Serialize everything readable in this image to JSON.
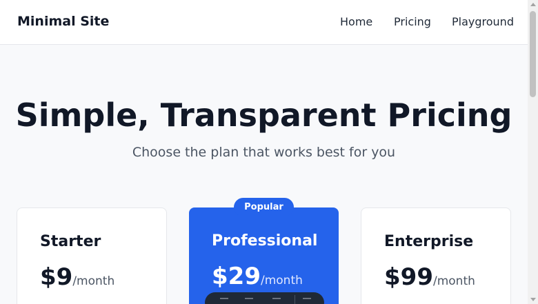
{
  "header": {
    "brand": "Minimal Site",
    "nav": [
      "Home",
      "Pricing",
      "Playground"
    ]
  },
  "hero": {
    "title": "Simple, Transparent Pricing",
    "subtitle": "Choose the plan that works best for you"
  },
  "plans": [
    {
      "name": "Starter",
      "price": "$9",
      "period": "/month"
    },
    {
      "name": "Professional",
      "price": "$29",
      "period": "/month",
      "badge": "Popular"
    },
    {
      "name": "Enterprise",
      "price": "$99",
      "period": "/month"
    }
  ],
  "colors": {
    "accent": "#2563eb",
    "background": "#f8f9fb",
    "text": "#111827"
  }
}
